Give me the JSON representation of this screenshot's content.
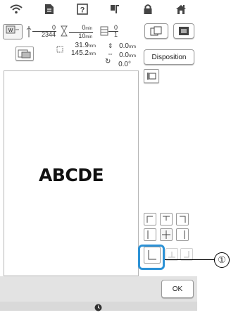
{
  "status_bar": {
    "icons": [
      "wifi-icon",
      "document-icon",
      "help-icon",
      "needle-mode-icon",
      "lock-icon",
      "home-icon"
    ]
  },
  "info": {
    "stitch_count": {
      "current": "0",
      "total": "2344"
    },
    "time": {
      "current": "0",
      "current_unit": "min",
      "total": "10",
      "total_unit": "min"
    },
    "color_changes": {
      "current": "0",
      "total": "1"
    },
    "pattern_size": {
      "width": "31.9",
      "height": "145.2",
      "unit": "mm"
    },
    "offset": {
      "vertical": "0.0",
      "horizontal": "0.0",
      "unit": "mm"
    },
    "rotation": "0.0°"
  },
  "buttons": {
    "disposition": "Disposition",
    "ok": "OK"
  },
  "pattern": {
    "text": "ABCDE"
  },
  "callout": {
    "number": "①"
  }
}
